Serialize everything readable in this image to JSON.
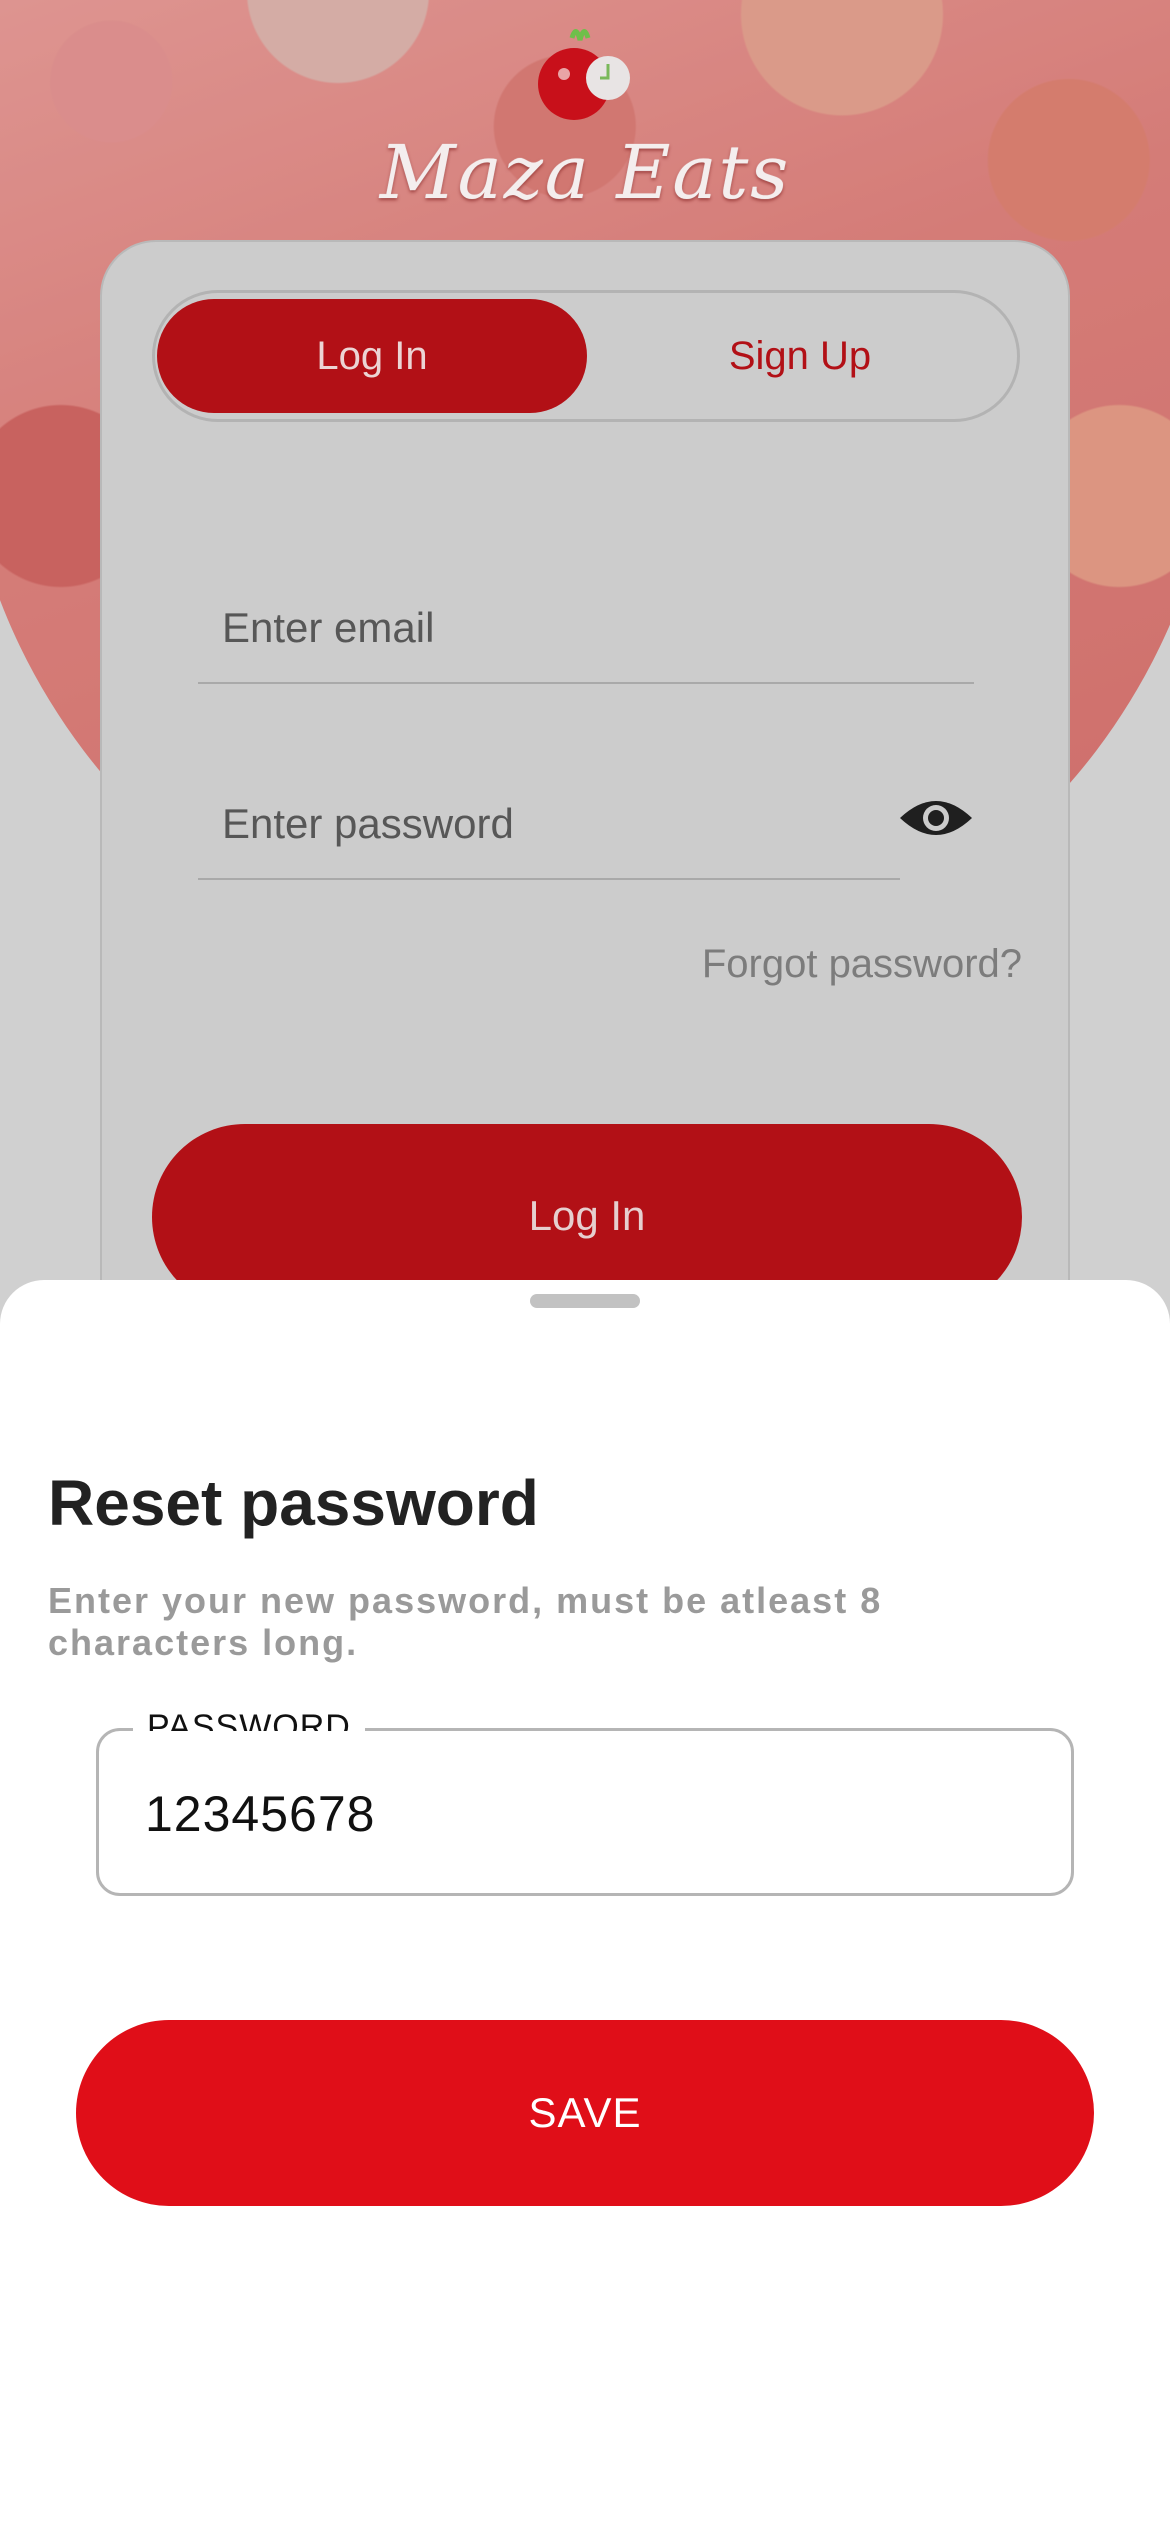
{
  "brand": {
    "name": "Maza Eats",
    "accent_color": "#b21016",
    "save_color": "#e00e18"
  },
  "auth_tabs": {
    "login_label": "Log In",
    "signup_label": "Sign Up",
    "active": "Log In"
  },
  "login_form": {
    "email_placeholder": "Enter email",
    "password_placeholder": "Enter password",
    "eye_icon": "eye-icon",
    "forgot_label": "Forgot password?",
    "submit_label": "Log In"
  },
  "reset_sheet": {
    "title": "Reset password",
    "subtitle": "Enter your new password, must be atleast 8 characters long.",
    "password_field": {
      "label": "PASSWORD",
      "value": "12345678"
    },
    "save_label": "SAVE"
  }
}
